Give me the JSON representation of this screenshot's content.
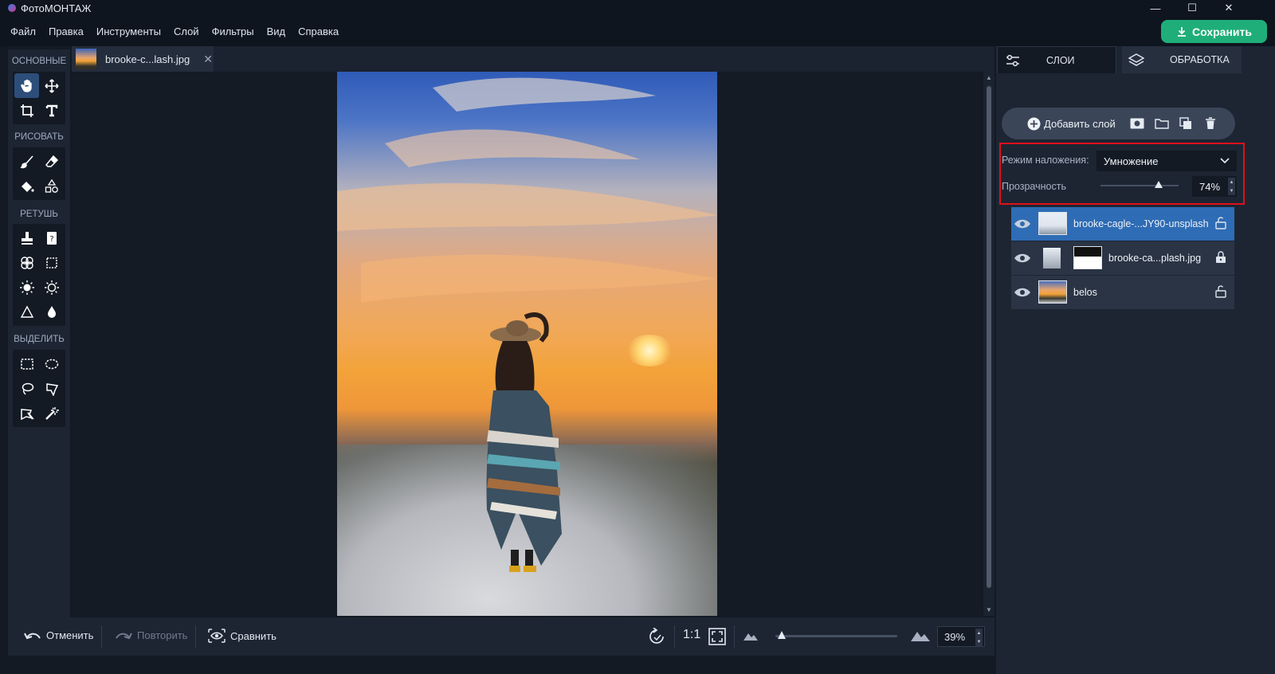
{
  "window": {
    "title": "ФотоМОНТАЖ",
    "minimize": "—",
    "maximize": "☐",
    "close": "✕"
  },
  "menu": [
    "Файл",
    "Правка",
    "Инструменты",
    "Слой",
    "Фильтры",
    "Вид",
    "Справка"
  ],
  "save_button": "Сохранить",
  "toolbar": {
    "sections": [
      {
        "title": "ОСНОВНЫЕ",
        "tools": [
          "hand-tool",
          "move-tool",
          "crop-tool",
          "text-tool"
        ]
      },
      {
        "title": "РИСОВАТЬ",
        "tools": [
          "brush-tool",
          "eraser-tool",
          "fill-tool",
          "shapes-tool"
        ]
      },
      {
        "title": "РЕТУШЬ",
        "tools": [
          "stamp-tool",
          "healing-tool",
          "patch-tool",
          "frame-tool",
          "dodge-tool",
          "burn-tool",
          "sharpen-tool",
          "blur-tool"
        ]
      },
      {
        "title": "ВЫДЕЛИТЬ",
        "tools": [
          "rect-select-tool",
          "ellipse-select-tool",
          "lasso-tool",
          "polygon-lasso-tool",
          "magnetic-lasso-tool",
          "magic-wand-tool"
        ]
      }
    ],
    "active_tool": "hand-tool"
  },
  "document_tab": {
    "name": "brooke-c...lash.jpg",
    "close": "✕"
  },
  "bottom_bar": {
    "undo": "Отменить",
    "redo": "Повторить",
    "compare": "Сравнить",
    "actual_size": "1:1",
    "zoom_value": "39%",
    "zoom_fraction": 0.05
  },
  "panel": {
    "tabs": [
      {
        "label": "СЛОИ",
        "icon": "sliders-icon",
        "active": true
      },
      {
        "label": "ОБРАБОТКА",
        "icon": "layers-icon",
        "active": false
      }
    ],
    "add_layer": "Добавить слой",
    "blend_mode_label": "Режим наложения:",
    "blend_mode_value": "Умножение",
    "opacity_label": "Прозрачность",
    "opacity_value": "74%",
    "opacity_fraction": 0.74,
    "layers": [
      {
        "name": "brooke-cagle-...JY90-unsplash",
        "selected": true,
        "has_mask": false,
        "locked": false
      },
      {
        "name": "brooke-ca...plash.jpg",
        "selected": false,
        "has_mask": true,
        "locked": true
      },
      {
        "name": "belos",
        "selected": false,
        "has_mask": false,
        "locked": false
      }
    ]
  },
  "colors": {
    "accent": "#1fae7a",
    "selection": "#2e6cb5",
    "highlight_box": "#e0101a"
  }
}
